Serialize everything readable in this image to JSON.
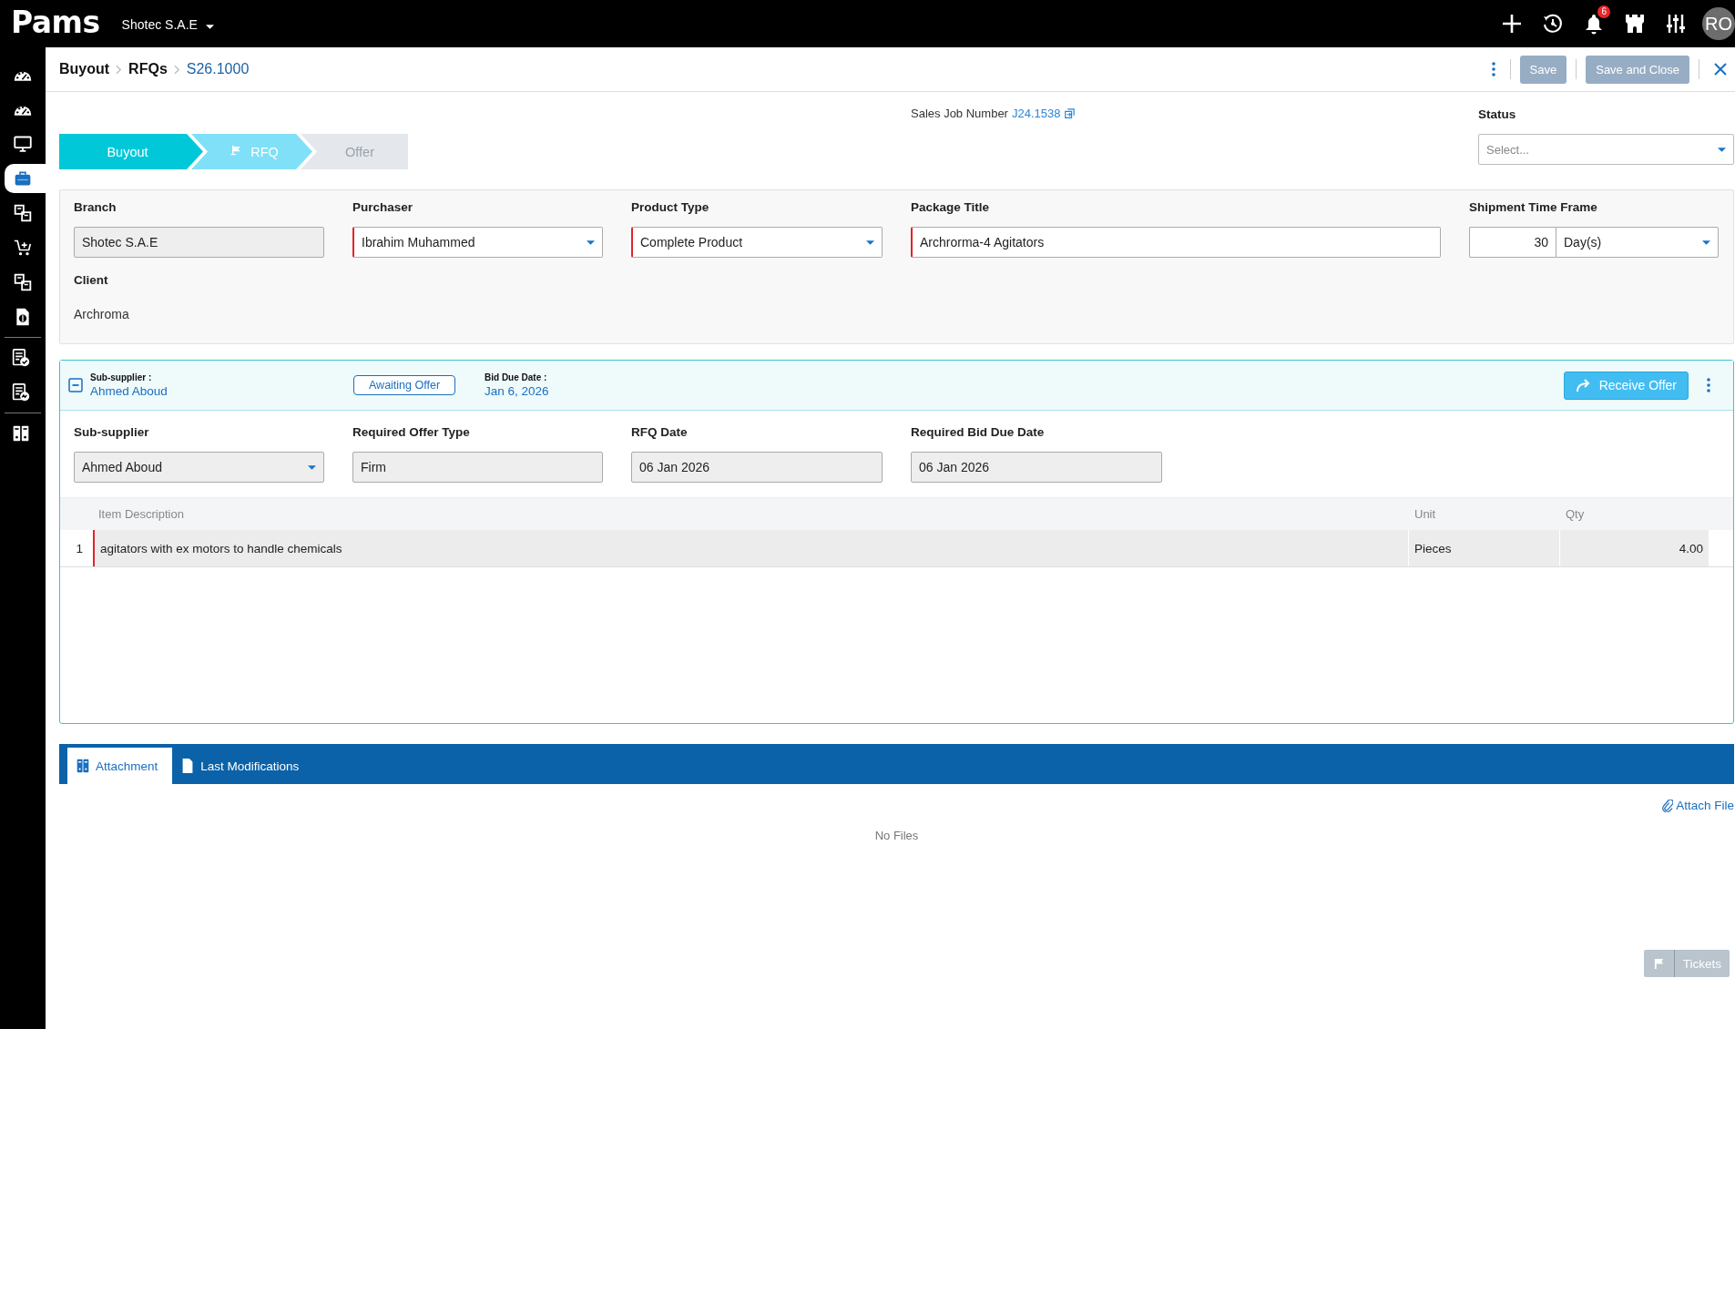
{
  "top_bar": {
    "logo": "Pams",
    "company": "Shotec S.A.E",
    "notification_count": "6",
    "avatar_initials": "RO"
  },
  "sidebar": {
    "groups": [
      {
        "items": [
          {
            "selected": false
          },
          {
            "selected": false
          },
          {
            "selected": false
          },
          {
            "selected": true
          },
          {
            "selected": false
          },
          {
            "selected": false
          },
          {
            "selected": false
          },
          {
            "selected": false
          }
        ]
      },
      {
        "items": [
          {
            "selected": false
          },
          {
            "selected": false
          }
        ]
      },
      {
        "items": [
          {
            "selected": false
          }
        ]
      }
    ]
  },
  "breadcrumb": [
    {
      "label": "Buyout",
      "current": false
    },
    {
      "label": "RFQs",
      "current": false
    },
    {
      "label": "S26.1000",
      "current": true
    }
  ],
  "toolbar": {
    "buttons": [
      {
        "label": "Save",
        "disabled": true
      },
      {
        "label": "Save and Close",
        "disabled": true
      }
    ]
  },
  "stepper": [
    {
      "label": "Buyout",
      "completed": true,
      "selected": false
    },
    {
      "label": "RFQ",
      "completed": false,
      "selected": true
    },
    {
      "label": "Offer",
      "completed": false,
      "selected": false
    }
  ],
  "sales_job": {
    "label": "Sales Job Number",
    "link": "J24.1538"
  },
  "status": {
    "label": "Status",
    "placeholder": "Select..."
  },
  "form": {
    "fields": [
      {
        "label": "Branch",
        "kind": "text",
        "value": "Shotec S.A.E",
        "disabled": true,
        "required": false
      },
      {
        "label": "Purchaser",
        "kind": "select",
        "value": "Ibrahim Muhammed",
        "disabled": false,
        "required": true
      },
      {
        "label": "Product Type",
        "kind": "select",
        "value": "Complete Product",
        "disabled": false,
        "required": true
      },
      {
        "label": "Package Title",
        "kind": "text",
        "value": "Archrorma-4 Agitators",
        "disabled": false,
        "required": true
      },
      {
        "label": "Shipment Time Frame",
        "kind": "number_unit",
        "value": "30",
        "unit": "Day(s)",
        "disabled": false,
        "required": false
      }
    ],
    "client": {
      "label": "Client",
      "value": "Archroma"
    }
  },
  "sub_supplier_card": {
    "expanded": true,
    "supplier_label": "Sub-supplier :",
    "supplier_name": "Ahmed Aboud",
    "status": "Awaiting Offer",
    "bid_due_label": "Bid Due Date :",
    "bid_due_date": "Jan 6, 2026",
    "action": "Receive Offer",
    "fields": [
      {
        "label": "Sub-supplier",
        "kind": "select",
        "value": "Ahmed Aboud",
        "disabled": true,
        "required": false
      },
      {
        "label": "Required Offer Type",
        "kind": "text",
        "value": "Firm",
        "disabled": true,
        "required": false
      },
      {
        "label": "RFQ Date",
        "kind": "text",
        "value": "06 Jan 2026",
        "disabled": true,
        "required": false
      },
      {
        "label": "Required Bid Due Date",
        "kind": "text",
        "value": "06 Jan 2026",
        "disabled": true,
        "required": false
      }
    ],
    "table": {
      "columns": [
        "Item Description",
        "Unit",
        "Qty"
      ],
      "rows": [
        {
          "number": "1",
          "cells": [
            "agitators with ex motors to handle chemicals",
            "Pieces",
            "4.00"
          ]
        }
      ]
    }
  },
  "bottom_tabs": [
    {
      "label": "Attachment",
      "selected": true
    },
    {
      "label": "Last Modifications",
      "selected": false
    }
  ],
  "attachments": {
    "action": "Attach File",
    "empty_text": "No Files"
  },
  "tickets_button": "Tickets"
}
